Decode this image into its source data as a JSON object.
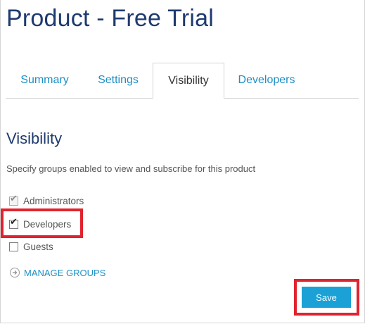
{
  "page": {
    "title": "Product - Free Trial"
  },
  "tabs": [
    {
      "label": "Summary",
      "active": false
    },
    {
      "label": "Settings",
      "active": false
    },
    {
      "label": "Visibility",
      "active": true
    },
    {
      "label": "Developers",
      "active": false
    }
  ],
  "visibility": {
    "heading": "Visibility",
    "description": "Specify groups enabled to view and subscribe for this product",
    "groups": [
      {
        "label": "Administrators",
        "checked": true,
        "disabled": true
      },
      {
        "label": "Developers",
        "checked": true,
        "disabled": false,
        "highlighted": true
      },
      {
        "label": "Guests",
        "checked": false,
        "disabled": false
      }
    ],
    "manage_link": "MANAGE GROUPS"
  },
  "actions": {
    "save_label": "Save",
    "save_highlighted": true
  },
  "colors": {
    "title": "#1e3a6e",
    "link": "#1e8fc6",
    "button": "#1ba1d6",
    "highlight": "#e0232e",
    "border": "#d4d4d4"
  },
  "icons": {
    "checkmark": "check-icon",
    "manage": "arrow-right-circle-icon"
  }
}
